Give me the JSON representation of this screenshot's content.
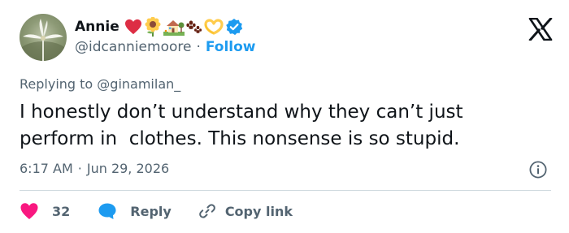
{
  "author": {
    "name": "Annie",
    "handle": "@idcanniemoore",
    "separator": "·",
    "follow_label": "Follow",
    "name_emojis": [
      "heart-icon",
      "sunflower-icon",
      "house-with-garden-icon",
      "paw-prints-icon",
      "heart-hands-icon"
    ],
    "verified": true
  },
  "reply_context": "Replying to @ginamilan_",
  "tweet": {
    "text": "I honestly don’t understand why they can’t just\nperform in  clothes. This nonsense is so stupid.",
    "time": "6:17 AM",
    "separator": "·",
    "date": "Jun 29, 2026"
  },
  "actions": {
    "like_count": "32",
    "reply_label": "Reply",
    "copy_label": "Copy link"
  },
  "colors": {
    "accent": "#1d9bf0",
    "like": "#f91880",
    "text_primary": "#0f1419",
    "text_secondary": "#536471",
    "divider": "#cfd9de"
  }
}
